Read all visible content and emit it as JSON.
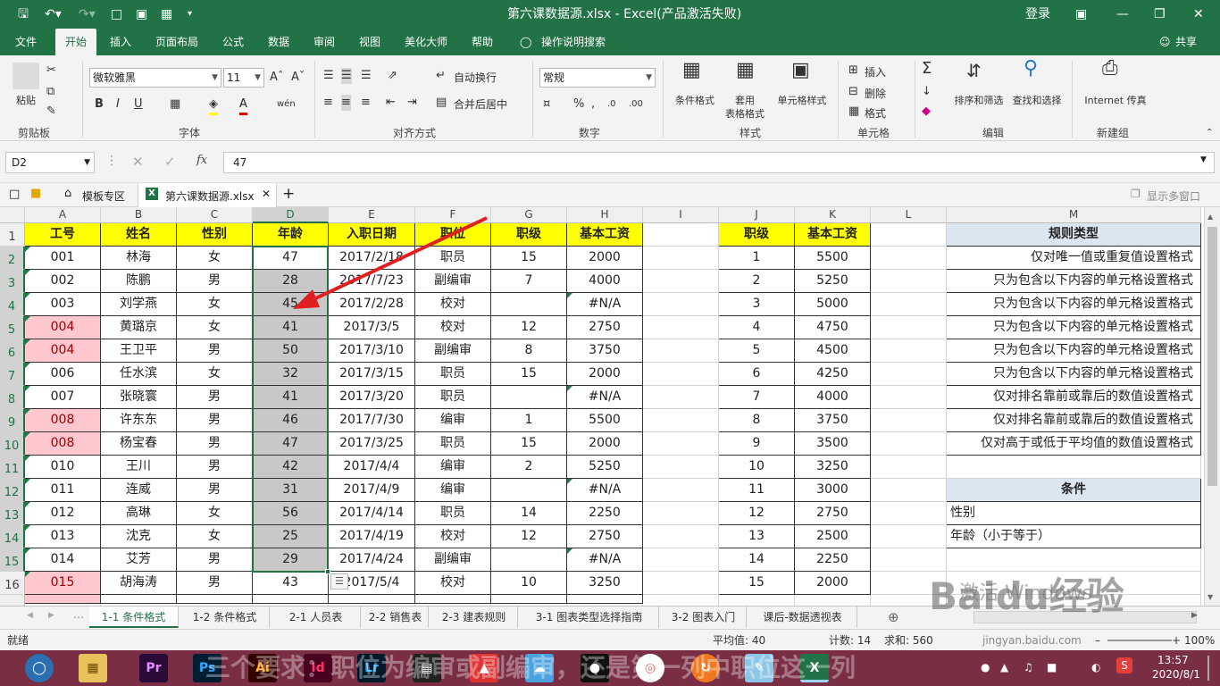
{
  "titlebar": {
    "title": "第六课数据源.xlsx  -  Excel(产品激活失败)",
    "login": "登录"
  },
  "ribbon_tabs": [
    "文件",
    "开始",
    "插入",
    "页面布局",
    "公式",
    "数据",
    "审阅",
    "视图",
    "美化大师",
    "帮助",
    "操作说明搜索"
  ],
  "share": "共享",
  "ribbon": {
    "clipboard": {
      "paste": "粘贴",
      "label": "剪贴板"
    },
    "font": {
      "name": "微软雅黑",
      "size": "11",
      "label": "字体"
    },
    "align": {
      "wrap": "自动换行",
      "merge": "合并后居中",
      "label": "对齐方式"
    },
    "number": {
      "format": "常规",
      "label": "数字"
    },
    "styles": {
      "cond": "条件格式",
      "table1": "套用",
      "table2": "表格格式",
      "cell": "单元格样式",
      "label": "样式"
    },
    "cells": {
      "insert": "插入",
      "delete": "删除",
      "format": "格式",
      "label": "单元格"
    },
    "edit": {
      "sort": "排序和筛选",
      "find": "查找和选择",
      "label": "编辑"
    },
    "web": {
      "btn": "Internet 传真",
      "label": "新建组"
    }
  },
  "formula": {
    "namebox": "D2",
    "value": "47"
  },
  "doctabs": {
    "t1": "模板专区",
    "t2": "第六课数据源.xlsx",
    "multi": "显示多窗口"
  },
  "columns": [
    "A",
    "B",
    "C",
    "D",
    "E",
    "F",
    "G",
    "H",
    "I",
    "J",
    "K",
    "L",
    "M"
  ],
  "rows": [
    "1",
    "2",
    "3",
    "4",
    "5",
    "6",
    "7",
    "8",
    "9",
    "10",
    "11",
    "12",
    "13",
    "14",
    "15",
    "16"
  ],
  "headers": [
    "工号",
    "姓名",
    "性别",
    "年龄",
    "入职日期",
    "职位",
    "职级",
    "基本工资"
  ],
  "table": [
    [
      "001",
      "林海",
      "女",
      "47",
      "2017/2/18",
      "职员",
      "15",
      "2000"
    ],
    [
      "002",
      "陈鹏",
      "男",
      "28",
      "2017/7/23",
      "副编审",
      "7",
      "4000"
    ],
    [
      "003",
      "刘学燕",
      "女",
      "45",
      "2017/2/28",
      "校对",
      "",
      "#N/A"
    ],
    [
      "004",
      "黄璐京",
      "女",
      "41",
      "2017/3/5",
      "校对",
      "12",
      "2750"
    ],
    [
      "004",
      "王卫平",
      "男",
      "50",
      "2017/3/10",
      "副编审",
      "8",
      "3750"
    ],
    [
      "006",
      "任水滨",
      "女",
      "32",
      "2017/3/15",
      "职员",
      "15",
      "2000"
    ],
    [
      "007",
      "张晓寰",
      "男",
      "41",
      "2017/3/20",
      "职员",
      "",
      "#N/A"
    ],
    [
      "008",
      "许东东",
      "男",
      "46",
      "2017/7/30",
      "编审",
      "1",
      "5500"
    ],
    [
      "008",
      "杨宝春",
      "男",
      "47",
      "2017/3/25",
      "职员",
      "15",
      "2000"
    ],
    [
      "010",
      "王川",
      "男",
      "42",
      "2017/4/4",
      "编审",
      "2",
      "5250"
    ],
    [
      "011",
      "连威",
      "男",
      "31",
      "2017/4/9",
      "编审",
      "",
      "#N/A"
    ],
    [
      "012",
      "高琳",
      "女",
      "56",
      "2017/4/14",
      "职员",
      "14",
      "2250"
    ],
    [
      "013",
      "沈克",
      "女",
      "25",
      "2017/4/19",
      "校对",
      "12",
      "2750"
    ],
    [
      "014",
      "艾芳",
      "男",
      "29",
      "2017/4/24",
      "副编审",
      "",
      "#N/A"
    ],
    [
      "015",
      "胡海涛",
      "男",
      "43",
      "2017/5/4",
      "校对",
      "10",
      "3250"
    ]
  ],
  "pink_rows": [
    3,
    4,
    7,
    8,
    14
  ],
  "lookup_headers": [
    "职级",
    "基本工资"
  ],
  "lookup": [
    [
      "1",
      "5500"
    ],
    [
      "2",
      "5250"
    ],
    [
      "3",
      "5000"
    ],
    [
      "4",
      "4750"
    ],
    [
      "5",
      "4500"
    ],
    [
      "6",
      "4250"
    ],
    [
      "7",
      "4000"
    ],
    [
      "8",
      "3750"
    ],
    [
      "9",
      "3500"
    ],
    [
      "10",
      "3250"
    ],
    [
      "11",
      "3000"
    ],
    [
      "12",
      "2750"
    ],
    [
      "13",
      "2500"
    ],
    [
      "14",
      "2250"
    ],
    [
      "15",
      "2000"
    ]
  ],
  "rules_header": "规则类型",
  "rules": [
    "仅对唯一值或重复值设置格式",
    "只为包含以下内容的单元格设置格式",
    "只为包含以下内容的单元格设置格式",
    "只为包含以下内容的单元格设置格式",
    "只为包含以下内容的单元格设置格式",
    "只为包含以下内容的单元格设置格式",
    "仅对排名靠前或靠后的数值设置格式",
    "仅对排名靠前或靠后的数值设置格式",
    "仅对高于或低于平均值的数值设置格式"
  ],
  "cond_header": "条件",
  "conds": [
    "性别",
    "年龄（小于等于）"
  ],
  "sheet_tabs": [
    "1-1 条件格式",
    "1-2 条件格式",
    "2-1 人员表",
    "2-2 销售表",
    "2-3 建表规则",
    "3-1 图表类型选择指南",
    "3-2 图表入门",
    "课后-数据透视表"
  ],
  "status": {
    "ready": "就绪",
    "avg": "平均值: 40",
    "count": "计数: 14",
    "sum": "求和: 560",
    "zoom": "100%"
  },
  "watermark": {
    "text": "三个要求：职位为编审或副编审，还是第一列中职位这一列",
    "baidu": "Baidu经验",
    "url": "jingyan.baidu.com",
    "activate": "激活 Windows"
  },
  "clock": {
    "time": "13:57",
    "date": "2020/8/1"
  },
  "taskbar_apps": [
    "Pr",
    "Ps",
    "Ai",
    "Id",
    "Lr",
    "X"
  ],
  "colors": {
    "excel_green": "#217346",
    "header_yellow": "#ffff00",
    "pink": "#ffc7ce",
    "selection_gray": "#c8c8c8",
    "arrow": "#e02020"
  }
}
